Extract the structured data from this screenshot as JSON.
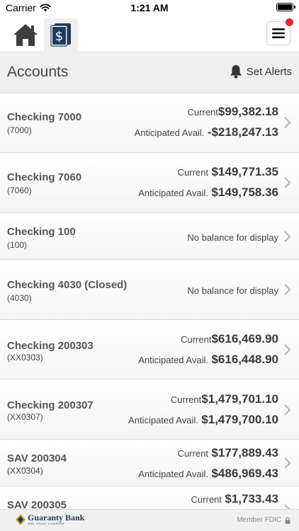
{
  "status_bar": {
    "carrier": "Carrier",
    "time": "1:21 AM"
  },
  "header": {
    "title": "Accounts",
    "set_alerts": "Set Alerts"
  },
  "accounts": [
    {
      "name": "Checking 7000",
      "number": "(7000)",
      "current_label": "Current",
      "current": "$99,382.18",
      "anticipated_label": "Anticipated Avail.",
      "anticipated": "-$218,247.13"
    },
    {
      "name": "Checking 7060",
      "number": "(7060)",
      "current_label": "Current",
      "current": "$149,771.35",
      "anticipated_label": "Anticipated Avail.",
      "anticipated": "$149,758.36"
    },
    {
      "name": "Checking 100",
      "number": "(100)",
      "no_balance": "No balance for display"
    },
    {
      "name": "Checking 4030 (Closed)",
      "number": "(4030)",
      "no_balance": "No balance for display"
    },
    {
      "name": "Checking 200303",
      "number": "(XX0303)",
      "current_label": "Current",
      "current": "$616,469.90",
      "anticipated_label": "Anticipated Avail.",
      "anticipated": "$616,448.90"
    },
    {
      "name": "Checking 200307",
      "number": "(XX0307)",
      "current_label": "Current",
      "current": "$1,479,701.10",
      "anticipated_label": "Anticipated Avail.",
      "anticipated": "$1,479,700.10"
    },
    {
      "name": "SAV 200304",
      "number": "(XX0304)",
      "current_label": "Current",
      "current": "$177,889.43",
      "anticipated_label": "Anticipated Avail.",
      "anticipated": "$486,969.43"
    },
    {
      "name": "SAV 200305",
      "number": "",
      "current_label": "Current",
      "current": "$1,733.43"
    }
  ],
  "footer": {
    "bank_name": "Guaranty Bank",
    "bank_sub": "AND TRUST COMPANY",
    "member": "Member FDIC"
  },
  "icons": {
    "home": "home-icon",
    "accounts": "dollar-document-icon",
    "menu": "hamburger-menu-icon",
    "alerts": "bell-icon",
    "chevron": "chevron-right-icon",
    "lock": "lock-icon"
  },
  "colors": {
    "accent_navy": "#1e3a5f",
    "badge_red": "#e3262f",
    "header_bg": "#efefef"
  }
}
